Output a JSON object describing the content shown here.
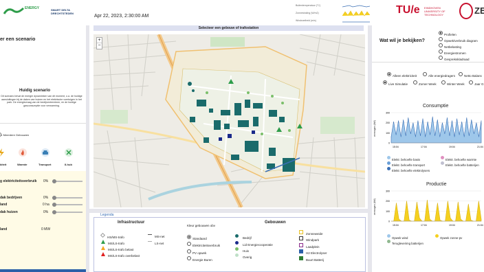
{
  "header": {
    "datetime": "Apr 22, 2023, 2:30:00 AM",
    "weather_labels": [
      "Buitentemperatuur (°C)",
      "Zonnestraling (W/m2)",
      "Windsnelheid (m/s)"
    ],
    "logo_left_1": "ENERGY",
    "logo_left_2": "SMART DELTA DRECHTSTEDEN",
    "logo_tue": "TU/e",
    "logo_tue_sub": "EINDHOVEN UNIVERSITY OF TECHNOLOGY",
    "logo_right": "ZE"
  },
  "left": {
    "scenario_title": "er een scenario",
    "current_title": "Huidig scenario",
    "current_text": "Dit scenario bevat de energie dynamieken van dit moment, o.a. de huidige aansluitingen bij de daken van huizen en het elektrische voertuigen in het park. De energievraag van de bedrijventerreinen, en de huidige gasconsumptie voor verwarming.",
    "buildings_label": "er Meerdere Gebouwen",
    "icons": [
      {
        "label": "kiteit",
        "icon": "bolt-icon",
        "color": "#e8a91c"
      },
      {
        "label": "Warmte",
        "icon": "flame-icon",
        "color": "#e05a3a"
      },
      {
        "label": "Transport",
        "icon": "car-icon",
        "color": "#3a7fb5"
      },
      {
        "label": "II-hub",
        "icon": "hub-icon",
        "color": "#2e9d4a"
      }
    ],
    "sliders": [
      {
        "label": "g elektriciteitsverbruik",
        "value": "0%",
        "level": 0
      },
      {
        "label": "dak bedrijven",
        "value": "0%",
        "level": 0
      },
      {
        "label": "land",
        "value": "0 ha",
        "level": 0
      },
      {
        "label": "dak huizen",
        "value": "0%",
        "level": 0
      }
    ],
    "extra_label": "land",
    "extra_value": "0 MW"
  },
  "map": {
    "title": "Selecteer een gebouw of trafostation",
    "zoom_in": "+",
    "zoom_out": "−"
  },
  "legend": {
    "tab": "Legenda",
    "infra_title": "Infrastructuur",
    "infra_items": [
      {
        "label": "HS/MS-trafo",
        "color": "#ffffff",
        "border": "#999999"
      },
      {
        "label": "MS/LS-trafo",
        "color": "#2e9d4a",
        "border": "#2e9d4a"
      },
      {
        "label": "MS/LS-trafo belast",
        "color": "#f5a623",
        "border": "#f5a623"
      },
      {
        "label": "MS/LS-trafo overbelast",
        "color": "#e02020",
        "border": "#e02020"
      }
    ],
    "lines": [
      {
        "label": "MS-net",
        "color": "#555555"
      },
      {
        "label": "LS-net",
        "color": "#aaaaaa"
      }
    ],
    "color_by_title": "Kleur gebouwen obv",
    "color_by_options": [
      "Standaard",
      "Elektriciteitsverbruik",
      "PV opwek",
      "Energie Buren"
    ],
    "color_by_selected": 0,
    "buildings_title": "Gebouwen",
    "building_items": [
      {
        "label": "Bedrijf",
        "color": "#1a6b6b",
        "shape": "circle"
      },
      {
        "label": "Lid Energiecooperatie",
        "color": "#1a2a8a",
        "shape": "circle"
      },
      {
        "label": "Huis",
        "color": "#7bbf6a",
        "shape": "circle"
      },
      {
        "label": "Overig",
        "color": "#bfe0c8",
        "shape": "circle"
      },
      {
        "label": "Zonneweide",
        "color": "#ffffff",
        "border": "#e8c020",
        "shape": "square"
      },
      {
        "label": "Windpark",
        "color": "#ffffff",
        "border": "#333333",
        "shape": "square"
      },
      {
        "label": "Laadplein",
        "color": "#ffffff",
        "border": "#8a2a8a",
        "shape": "square"
      },
      {
        "label": "H2 Electrolyser",
        "color": "#2a5fa8",
        "border": "#2a5fa8",
        "shape": "square"
      },
      {
        "label": "Buurt Batterij",
        "color": "#2e7d32",
        "border": "#2e7d32",
        "shape": "square"
      }
    ]
  },
  "right": {
    "question": "Wat wil je bekijken?",
    "view_options": [
      "Profielen",
      "Opwek/verbruik diagram",
      "Netbelasting",
      "Energiestromen",
      "Gesprekskladraad"
    ],
    "view_selected": 0,
    "carrier_options": [
      "Alleen elektriciteit",
      "Alle energiedragers",
      "Netto Balans"
    ],
    "carrier_selected": 0,
    "period_options": [
      "Live Simulatie",
      "Zomer Week",
      "Winter Week",
      "Jaar G"
    ],
    "period_selected": 0,
    "consumption_title": "Consumptie",
    "consumption_legend": [
      {
        "label": "Elektr. behoefte basis",
        "color": "#9ec7ea"
      },
      {
        "label": "Elektr. behoefte warmte",
        "color": "#e090c0"
      },
      {
        "label": "Elektr. behoefte transport",
        "color": "#6a9fd8"
      },
      {
        "label": "Elektr. behoefte batterijen",
        "color": "#c0c0d0"
      },
      {
        "label": "Elektr. behoefte elektrolysers",
        "color": "#3a6fb5"
      }
    ],
    "production_title": "Productie",
    "production_legend": [
      {
        "label": "Opwek wind",
        "color": "#9ec7ea"
      },
      {
        "label": "Opwek zonne-pv",
        "color": "#f5d020"
      },
      {
        "label": "Terugleverimg batterijen",
        "color": "#90b890"
      }
    ],
    "ylabel": "vermogen (kW)",
    "xticks": [
      "15:04",
      "17:04",
      "19:04",
      "21:04"
    ],
    "cons_yticks": [
      "0",
      "100",
      "200",
      "300"
    ],
    "prod_yticks": [
      "0",
      "100",
      "200",
      "300"
    ]
  },
  "chart_data": [
    {
      "type": "area",
      "title": "Consumptie",
      "ylabel": "vermogen (kW)",
      "xticks": [
        "15:04",
        "17:04",
        "19:04",
        "21:04"
      ],
      "ylim": [
        0,
        300
      ],
      "values": [
        60,
        210,
        80,
        220,
        60,
        230,
        70,
        250,
        90,
        200,
        60,
        220,
        70,
        240,
        60,
        210,
        80,
        260,
        70,
        230,
        60,
        200,
        90,
        250,
        70,
        220,
        60,
        240,
        80,
        210,
        60,
        250,
        70,
        230,
        90,
        200,
        60,
        220
      ]
    },
    {
      "type": "area",
      "title": "Productie",
      "ylabel": "vermogen (kW)",
      "xticks": [
        "15:04",
        "17:04",
        "19:04",
        "21:04"
      ],
      "ylim": [
        0,
        300
      ],
      "values": [
        0,
        0,
        180,
        20,
        0,
        0,
        200,
        10,
        0,
        0,
        190,
        30,
        0,
        0,
        210,
        20,
        0,
        0,
        180,
        10,
        0,
        0,
        200,
        30,
        0,
        0,
        190,
        20,
        0,
        0,
        170,
        10,
        0,
        0,
        200,
        20
      ]
    }
  ]
}
